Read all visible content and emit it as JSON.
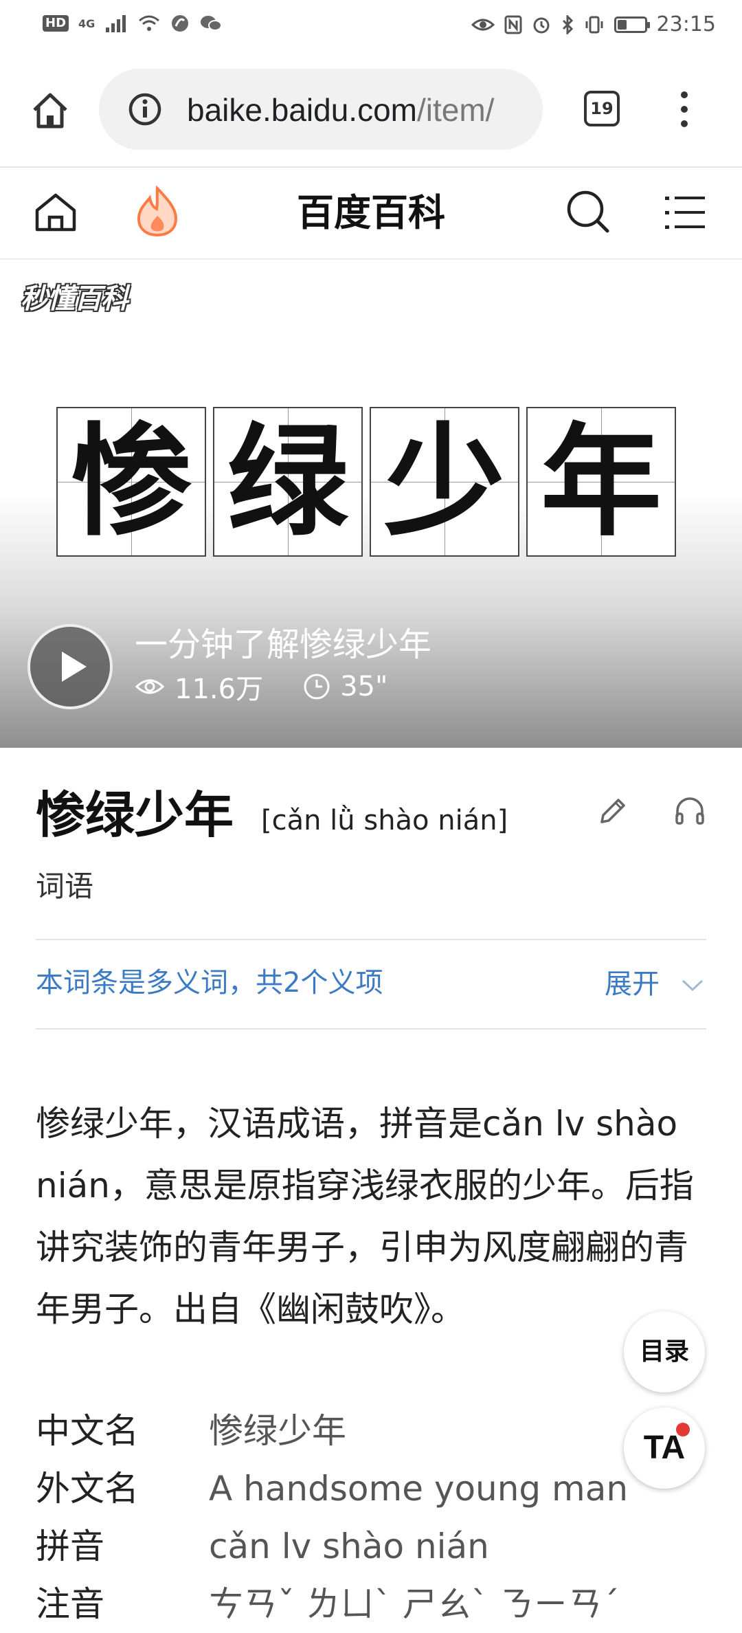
{
  "status_bar": {
    "hd": "HD",
    "network": "4G",
    "time": "23:15",
    "battery_level": 0.35
  },
  "browser": {
    "url_main": "baike.baidu.com",
    "url_path": "/item/",
    "tab_count": "19"
  },
  "header": {
    "title": "百度百科"
  },
  "video": {
    "brand": "秒懂百科",
    "characters": [
      "惨",
      "绿",
      "少",
      "年"
    ],
    "title": "一分钟了解惨绿少年",
    "views": "11.6万",
    "duration": "35\""
  },
  "entry": {
    "title": "惨绿少年",
    "pinyin": "[cǎn lǜ shào nián]",
    "type": "词语",
    "polysemy_note": "本词条是多义词，共2个义项",
    "expand_label": "展开",
    "summary": "惨绿少年，汉语成语，拼音是cǎn lv shào nián，意思是原指穿浅绿衣服的少年。后指讲究装饰的青年男子，引申为风度翩翩的青年男子。出自《幽闲鼓吹》。"
  },
  "info": [
    {
      "key": "中文名",
      "value": "惨绿少年"
    },
    {
      "key": "外文名",
      "value": "A handsome young man"
    },
    {
      "key": "拼音",
      "value": "cǎn lv shào nián"
    },
    {
      "key": "注音",
      "value": "ㄘㄢˇ ㄌㄩˋ ㄕㄠˋ ㄋㄧㄢˊ"
    }
  ],
  "fab": {
    "toc_label": "目录",
    "ta_label": "TA"
  }
}
